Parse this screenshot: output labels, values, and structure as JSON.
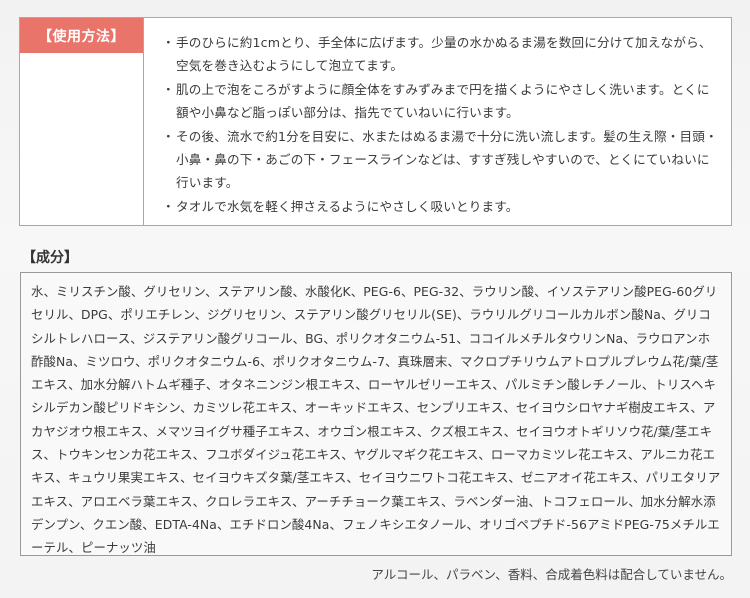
{
  "usage": {
    "label": "【使用方法】",
    "bullet": "・",
    "items": [
      "手のひらに約1cmとり、手全体に広げます。少量の水かぬるま湯を数回に分けて加えながら、空気を巻き込むようにして泡立てます。",
      "肌の上で泡をころがすように顔全体をすみずみまで円を描くようにやさしく洗います。とくに額や小鼻など脂っぽい部分は、指先でていねいに行います。",
      "その後、流水で約1分を目安に、水またはぬるま湯で十分に洗い流します。髪の生え際・目頭・小鼻・鼻の下・あごの下・フェースラインなどは、すすぎ残しやすいので、とくにていねいに行います。",
      "タオルで水気を軽く押さえるようにやさしく吸いとります。"
    ]
  },
  "ingredients": {
    "title": "【成分】",
    "text": "水、ミリスチン酸、グリセリン、ステアリン酸、水酸化K、PEG-6、PEG-32、ラウリン酸、イソステアリン酸PEG-60グリセリル、DPG、ポリエチレン、ジグリセリン、ステアリン酸グリセリル(SE)、ラウリルグリコールカルボン酸Na、グリコシルトレハロース、ジステアリン酸グリコール、BG、ポリクオタニウム-51、ココイルメチルタウリンNa、ラウロアンホ酢酸Na、ミツロウ、ポリクオタニウム-6、ポリクオタニウム-7、真珠層末、マクロプチリウムアトロプルプレウム花/葉/茎エキス、加水分解ハトムギ種子、オタネニンジン根エキス、ローヤルゼリーエキス、パルミチン酸レチノール、トリスヘキシルデカン酸ピリドキシン、カミツレ花エキス、オーキッドエキス、センブリエキス、セイヨウシロヤナギ樹皮エキス、アカヤジオウ根エキス、メマツヨイグサ種子エキス、オウゴン根エキス、クズ根エキス、セイヨウオトギリソウ花/葉/茎エキス、トウキンセンカ花エキス、フユボダイジュ花エキス、ヤグルマギク花エキス、ローマカミツレ花エキス、アルニカ花エキス、キュウリ果実エキス、セイヨウキズタ葉/茎エキス、セイヨウニワトコ花エキス、ゼニアオイ花エキス、パリエタリアエキス、アロエベラ葉エキス、クロレラエキス、アーチチョーク葉エキス、ラベンダー油、トコフェロール、加水分解水添デンプン、クエン酸、EDTA-4Na、エチドロン酸4Na、フェノキシエタノール、オリゴペプチド-56アミドPEG-75メチルエーテル、ピーナッツ油"
  },
  "footnote": "アルコール、パラベン、香料、合成着色料は配合していません。",
  "colors": {
    "accent": "#e8746a",
    "border": "#ea8d85"
  }
}
